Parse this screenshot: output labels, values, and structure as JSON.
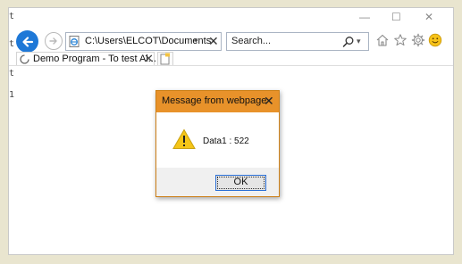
{
  "window": {
    "minimize_glyph": "—",
    "maximize_glyph": "☐",
    "close_glyph": "✕"
  },
  "nav": {
    "address": "C:\\Users\\ELCOT\\Documents",
    "address_dropdown_glyph": "▾",
    "address_close_glyph": "✕",
    "search_placeholder": "Search...",
    "search_dropdown_glyph": "▾",
    "icons": [
      "back-arrow-icon",
      "forward-arrow-icon",
      "ie-page-icon",
      "search-icon",
      "home-icon",
      "star-icon",
      "gear-icon",
      "smiley-icon"
    ]
  },
  "tabs": [
    {
      "label": "Demo Program - To test Al...",
      "close_glyph": "✕"
    }
  ],
  "background_fragments": [
    "t",
    "t",
    "t",
    "1"
  ],
  "dialog": {
    "title": "Message from webpage",
    "close_glyph": "✕",
    "message": "Data1 : 522",
    "ok_label": "OK",
    "title_color": "#e8922a"
  },
  "colors": {
    "accent": "#1e78d7",
    "dialog_title": "#e8922a",
    "warning_yellow": "#f5c518"
  }
}
